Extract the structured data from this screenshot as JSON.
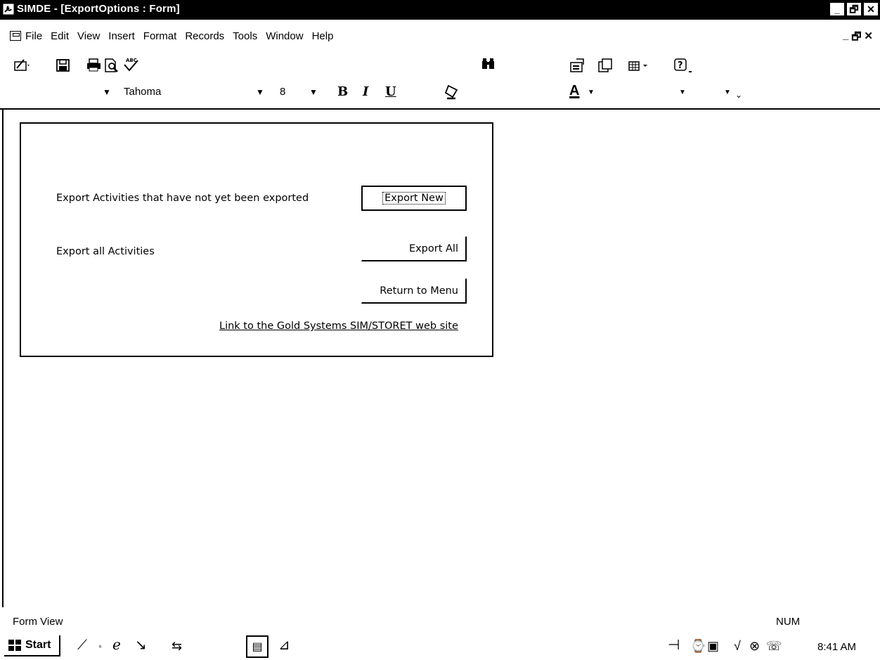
{
  "window": {
    "title": "SIMDE - [ExportOptions : Form]",
    "controls": [
      "_",
      "🗗",
      "✕"
    ]
  },
  "menubar": {
    "items": [
      "File",
      "Edit",
      "View",
      "Insert",
      "Format",
      "Records",
      "Tools",
      "Window",
      "Help"
    ],
    "mdi_controls": [
      "_",
      "🗗",
      "✕"
    ]
  },
  "formatting_toolbar": {
    "font_name": "Tahoma",
    "font_size": "8",
    "bold": "B",
    "italic": "I",
    "underline": "U",
    "font_color": "A"
  },
  "form": {
    "rows": [
      {
        "label": "Export Activities that have not yet been exported",
        "button": "Export New"
      },
      {
        "label": "Export all Activities",
        "button": "Export All"
      }
    ],
    "return_button": "Return to Menu",
    "link": "Link to the Gold Systems SIM/STORET web site"
  },
  "statusbar": {
    "left": "Form View",
    "right": "NUM"
  },
  "taskbar": {
    "start_label": "Start",
    "clock": "8:41 AM"
  }
}
